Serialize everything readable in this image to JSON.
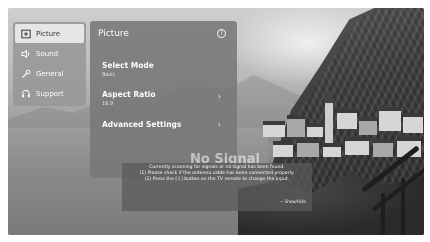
{
  "menu": {
    "items": [
      {
        "label": "Picture",
        "icon": "picture-icon",
        "active": true
      },
      {
        "label": "Sound",
        "icon": "speaker-icon",
        "active": false
      },
      {
        "label": "General",
        "icon": "wrench-icon",
        "active": false
      },
      {
        "label": "Support",
        "icon": "headset-icon",
        "active": false
      }
    ]
  },
  "panel": {
    "title": "Picture",
    "options": [
      {
        "label": "Select Mode",
        "value": "Basic"
      },
      {
        "label": "Aspect Ratio",
        "value": "16:9"
      },
      {
        "label": "Advanced Settings",
        "value": ""
      }
    ]
  },
  "notice": {
    "title": "No Signal",
    "lines": [
      "Currently scanning for signals or no signal has been found.",
      "(1) Please check if the antenna cable has been connected properly.",
      "(2) Press the [⇩] button on the TV remote to change the input."
    ],
    "show_hide": "— Show/Hide"
  }
}
